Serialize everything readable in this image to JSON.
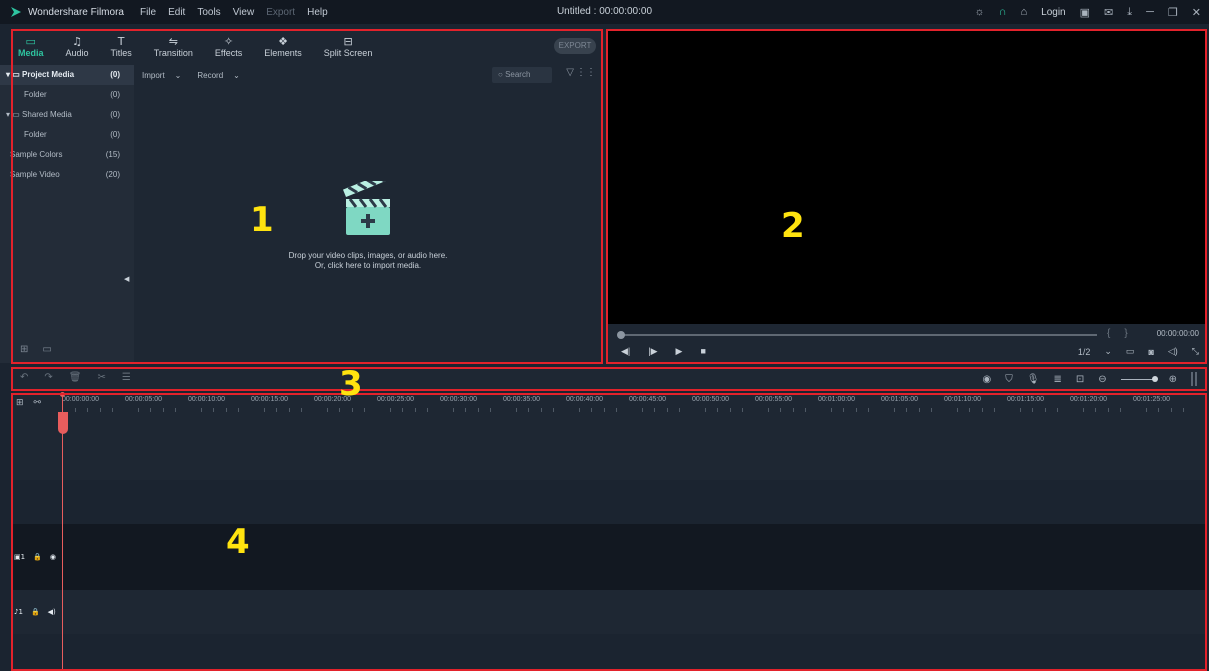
{
  "titlebar": {
    "app_name": "Wondershare Filmora",
    "menu": [
      "File",
      "Edit",
      "Tools",
      "View",
      "Export",
      "Help"
    ],
    "document_title": "Untitled : 00:00:00:00",
    "login_label": "Login"
  },
  "library": {
    "tabs": [
      {
        "label": "Media",
        "icon": "folder-icon",
        "active": true
      },
      {
        "label": "Audio",
        "icon": "music-icon"
      },
      {
        "label": "Titles",
        "icon": "text-icon"
      },
      {
        "label": "Transition",
        "icon": "transition-icon"
      },
      {
        "label": "Effects",
        "icon": "effects-icon"
      },
      {
        "label": "Elements",
        "icon": "elements-icon"
      },
      {
        "label": "Split Screen",
        "icon": "split-screen-icon"
      }
    ],
    "export_label": "EXPORT",
    "tree": [
      {
        "label": "Project Media",
        "count": "(0)"
      },
      {
        "label": "Folder",
        "count": "(0)"
      },
      {
        "label": "Shared Media",
        "count": "(0)"
      },
      {
        "label": "Folder",
        "count": "(0)"
      },
      {
        "label": "Sample Colors",
        "count": "(15)"
      },
      {
        "label": "Sample Video",
        "count": "(20)"
      }
    ],
    "import_label": "Import",
    "record_label": "Record",
    "search_placeholder": "Search",
    "drop_line1": "Drop your video clips, images, or audio here.",
    "drop_line2": "Or, click here to import media."
  },
  "preview": {
    "time": "00:00:00:00",
    "quality": "1/2"
  },
  "timeline": {
    "ruler_ticks": [
      "00:00:00:00",
      "00:00:05:00",
      "00:00:10:00",
      "00:00:15:00",
      "00:00:20:00",
      "00:00:25:00",
      "00:00:30:00",
      "00:00:35:00",
      "00:00:40:00",
      "00:00:45:00",
      "00:00:50:00",
      "00:00:55:00",
      "00:01:00:00",
      "00:01:05:00",
      "00:01:10:00",
      "00:01:15:00",
      "00:01:20:00",
      "00:01:25:00"
    ],
    "video_track_label": "1",
    "audio_track_label": "1"
  },
  "annotations": {
    "n1": "1",
    "n2": "2",
    "n3": "3",
    "n4": "4"
  },
  "colors": {
    "accent": "#2ec4a0",
    "frame": "#e3222b",
    "label": "#ffe30f",
    "playhead": "#e85d5d"
  }
}
